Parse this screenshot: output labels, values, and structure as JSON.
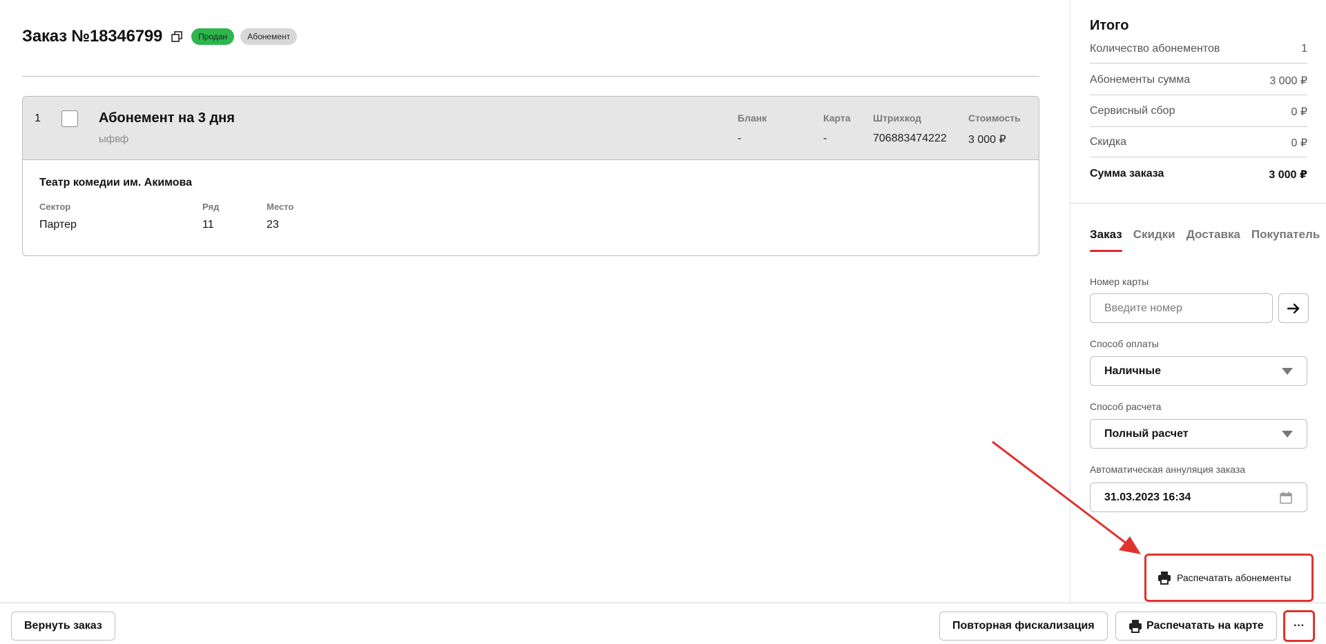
{
  "order": {
    "title": "Заказ №18346799",
    "status_badge": "Продан",
    "type_badge": "Абонемент"
  },
  "ticket": {
    "index": "1",
    "name": "Абонемент на 3 дня",
    "subtitle": "ыфвф",
    "columns": {
      "blank": {
        "label": "Бланк",
        "value": "-"
      },
      "card": {
        "label": "Карта",
        "value": "-"
      },
      "barcode": {
        "label": "Штрихкод",
        "value": "706883474222"
      },
      "cost": {
        "label": "Стоимость",
        "value": "3 000 ₽"
      }
    },
    "venue": "Театр комедии им. Акимова",
    "seat": {
      "sector": {
        "label": "Сектор",
        "value": "Партер"
      },
      "row": {
        "label": "Ряд",
        "value": "11"
      },
      "place": {
        "label": "Место",
        "value": "23"
      }
    }
  },
  "summary": {
    "title": "Итого",
    "rows": [
      {
        "label": "Количество абонементов",
        "value": "1"
      },
      {
        "label": "Абонементы сумма",
        "value": "3 000 ₽"
      },
      {
        "label": "Сервисный сбор",
        "value": "0 ₽"
      },
      {
        "label": "Скидка",
        "value": "0 ₽"
      }
    ],
    "total": {
      "label": "Сумма заказа",
      "value": "3 000 ₽"
    }
  },
  "tabs": [
    {
      "label": "Заказ",
      "active": true
    },
    {
      "label": "Скидки",
      "active": false
    },
    {
      "label": "Доставка",
      "active": false
    },
    {
      "label": "Покупатель",
      "active": false
    }
  ],
  "form": {
    "card_number": {
      "label": "Номер карты",
      "placeholder": "Введите номер",
      "value": ""
    },
    "payment_method": {
      "label": "Способ оплаты",
      "value": "Наличные"
    },
    "settlement_method": {
      "label": "Способ расчета",
      "value": "Полный расчет"
    },
    "auto_cancel": {
      "label": "Автоматическая аннуляция заказа",
      "value": "31.03.2023 16:34"
    }
  },
  "popup": {
    "print_subscriptions": "Распечатать абонементы"
  },
  "footer": {
    "return_order": "Вернуть заказ",
    "refiscalize": "Повторная фискализация",
    "print_on_card": "Распечатать на карте",
    "more": "···"
  },
  "colors": {
    "accent_red": "#e0262b",
    "sold_green": "#2fb64f",
    "annotation_red": "#e0332d"
  },
  "icons": [
    "copy-icon",
    "arrow-right-icon",
    "chevron-down-icon",
    "calendar-icon",
    "printer-icon",
    "more-dots-icon"
  ]
}
